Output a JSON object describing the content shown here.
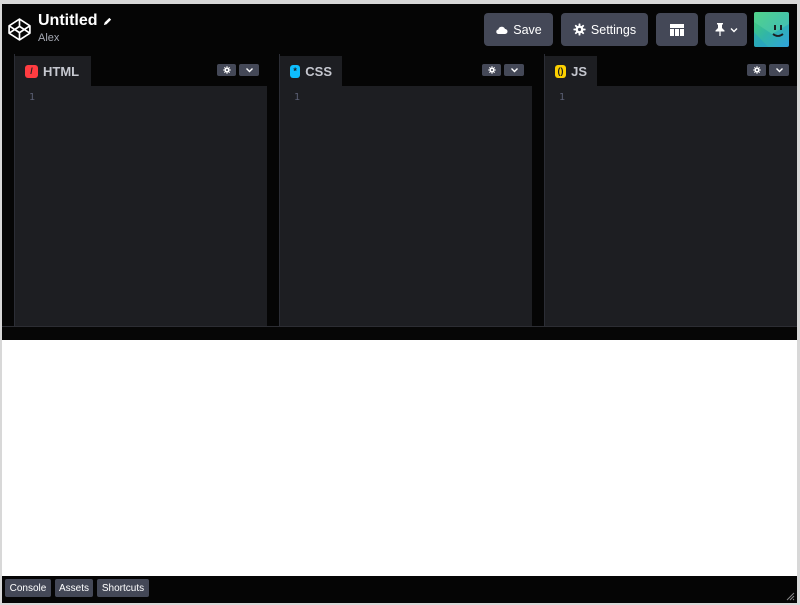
{
  "header": {
    "title": "Untitled",
    "author": "Alex",
    "logo_icon": "codepen-logo-icon",
    "edit_icon": "pencil-icon"
  },
  "toolbar": {
    "save_label": "Save",
    "save_icon": "cloud-icon",
    "settings_label": "Settings",
    "settings_icon": "gear-icon",
    "layout_icon": "layout-grid-icon",
    "pin_icon": "pin-icon"
  },
  "editors": [
    {
      "label": "HTML",
      "icon": "html-icon",
      "icon_glyph": "/",
      "accent": "#ff3c41",
      "line": "1"
    },
    {
      "label": "CSS",
      "icon": "css-icon",
      "icon_glyph": "*",
      "accent": "#0ebeff",
      "line": "1"
    },
    {
      "label": "JS",
      "icon": "js-icon",
      "icon_glyph": "()",
      "accent": "#fcd000",
      "line": "1"
    }
  ],
  "footer": {
    "console_label": "Console",
    "assets_label": "Assets",
    "shortcuts_label": "Shortcuts"
  },
  "colors": {
    "header_bg": "#050505",
    "button_bg": "#444857",
    "editor_bg": "#1d1e22",
    "preview_bg": "#ffffff"
  }
}
